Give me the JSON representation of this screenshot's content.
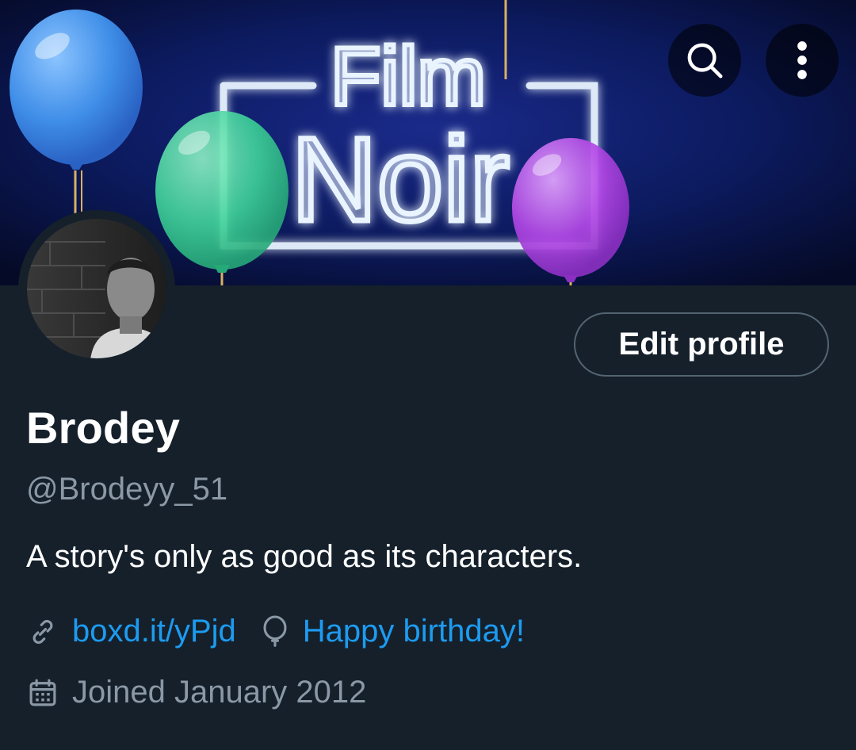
{
  "banner": {
    "line1": "Film",
    "line2": "Noir"
  },
  "header_actions": {
    "search_icon": "search-icon",
    "more_icon": "more-vertical-icon"
  },
  "profile": {
    "edit_label": "Edit profile",
    "name": "Brodey",
    "handle": "@Brodeyy_51",
    "bio": "A story's only as good as its characters.",
    "website": "boxd.it/yPjd",
    "birthday": "Happy birthday!",
    "joined": "Joined January 2012"
  },
  "colors": {
    "background": "#15202b",
    "accent": "#1d9bf0",
    "muted": "#8b98a5",
    "border": "#536471",
    "balloon_blue": "#3f8ee8",
    "balloon_green": "#3fd39a",
    "balloon_purple": "#b247e6",
    "neon": "#e9f4ff"
  }
}
